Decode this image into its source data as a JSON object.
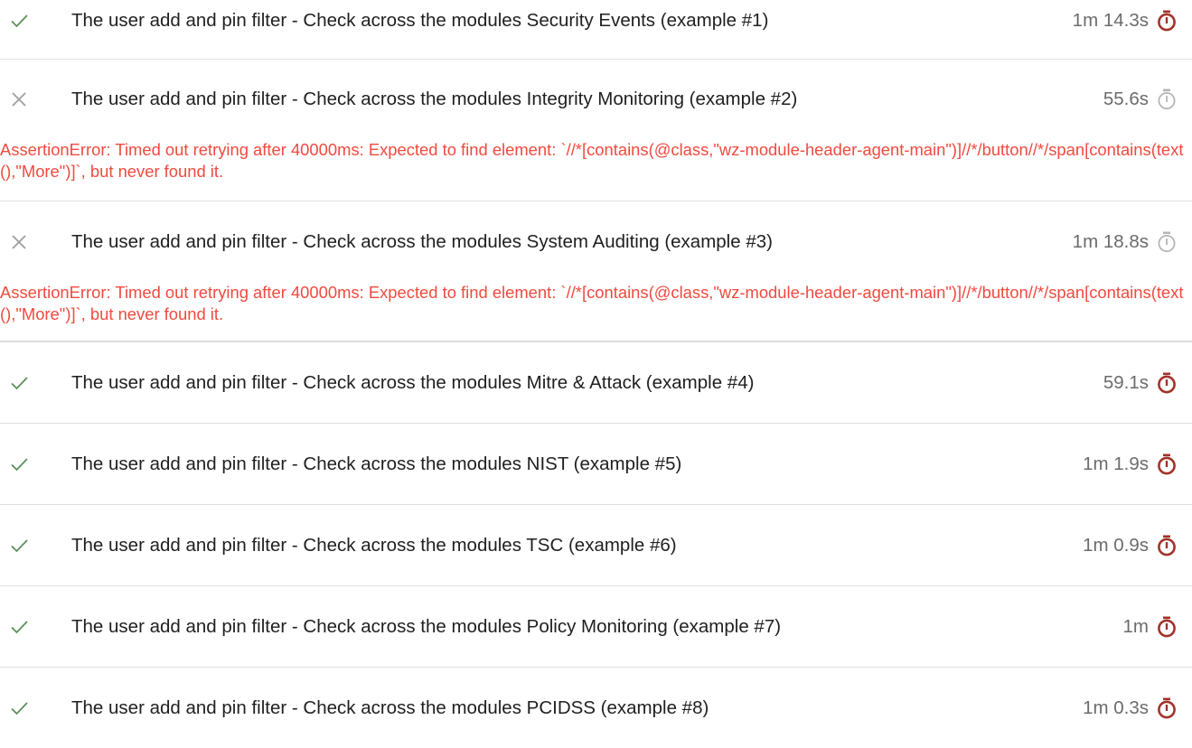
{
  "colors": {
    "pass_check": "#5b8f5b",
    "fail_cross": "#9e9e9e",
    "timer_pass": "#a0342a",
    "timer_fail": "#b5b5b5",
    "error_text": "#f04a3e"
  },
  "tests": [
    {
      "status": "passed",
      "status_icon": "check-icon",
      "title": "The user add and pin filter - Check across the modules Security Events (example #1)",
      "duration": "1m 14.3s",
      "timer_icon": "stopwatch-icon"
    },
    {
      "status": "failed",
      "status_icon": "cross-icon",
      "title": "The user add and pin filter - Check across the modules Integrity Monitoring (example #2)",
      "duration": "55.6s",
      "timer_icon": "stopwatch-icon",
      "error": "AssertionError: Timed out retrying after 40000ms: Expected to find element: `//*[contains(@class,\"wz-module-header-agent-main\")]//*/button//*/span[contains(text(),\"More\")]`, but never found it."
    },
    {
      "status": "failed",
      "status_icon": "cross-icon",
      "title": "The user add and pin filter - Check across the modules System Auditing (example #3)",
      "duration": "1m 18.8s",
      "timer_icon": "stopwatch-icon",
      "error": "AssertionError: Timed out retrying after 40000ms: Expected to find element: `//*[contains(@class,\"wz-module-header-agent-main\")]//*/button//*/span[contains(text(),\"More\")]`, but never found it."
    },
    {
      "status": "passed",
      "status_icon": "check-icon",
      "title": "The user add and pin filter - Check across the modules Mitre & Attack (example #4)",
      "duration": "59.1s",
      "timer_icon": "stopwatch-icon"
    },
    {
      "status": "passed",
      "status_icon": "check-icon",
      "title": "The user add and pin filter - Check across the modules NIST (example #5)",
      "duration": "1m 1.9s",
      "timer_icon": "stopwatch-icon"
    },
    {
      "status": "passed",
      "status_icon": "check-icon",
      "title": "The user add and pin filter - Check across the modules TSC (example #6)",
      "duration": "1m 0.9s",
      "timer_icon": "stopwatch-icon"
    },
    {
      "status": "passed",
      "status_icon": "check-icon",
      "title": "The user add and pin filter - Check across the modules Policy Monitoring (example #7)",
      "duration": "1m",
      "timer_icon": "stopwatch-icon"
    },
    {
      "status": "passed",
      "status_icon": "check-icon",
      "title": "The user add and pin filter - Check across the modules PCIDSS (example #8)",
      "duration": "1m 0.3s",
      "timer_icon": "stopwatch-icon"
    }
  ]
}
